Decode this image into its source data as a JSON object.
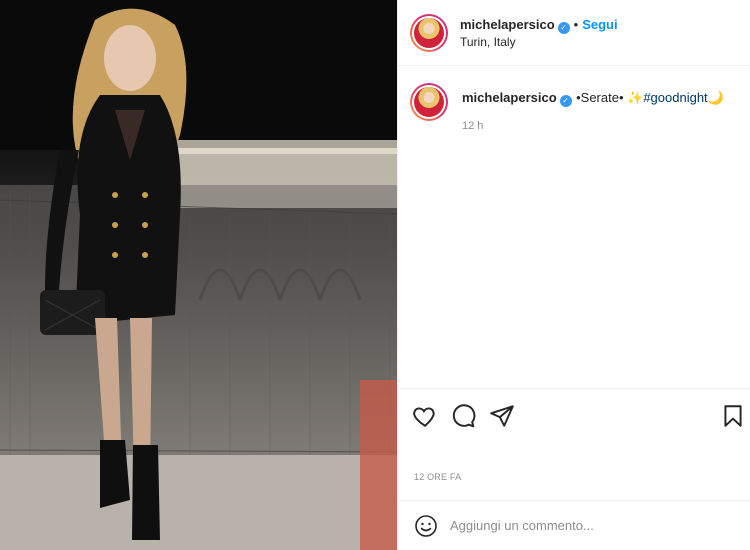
{
  "post": {
    "username": "michelapersico",
    "verified_badge": "✓",
    "separator": "•",
    "follow_label": "Segui",
    "location": "Turin, Italy",
    "caption": "•Serate• ",
    "caption_emoji_star": "✨",
    "hashtag": "#goodnight",
    "caption_emoji_moon": "🌙",
    "caption_time": "12 h",
    "timestamp": "12 ORE FA"
  },
  "actions": {
    "like_icon": "heart-icon",
    "comment_icon": "comment-icon",
    "share_icon": "send-icon",
    "save_icon": "bookmark-icon"
  },
  "comment": {
    "placeholder": "Aggiungi un commento..."
  },
  "colors": {
    "accent": "#0095f6",
    "verified": "#3897f0",
    "hashtag": "#00376b",
    "muted": "#8e8e8e"
  }
}
